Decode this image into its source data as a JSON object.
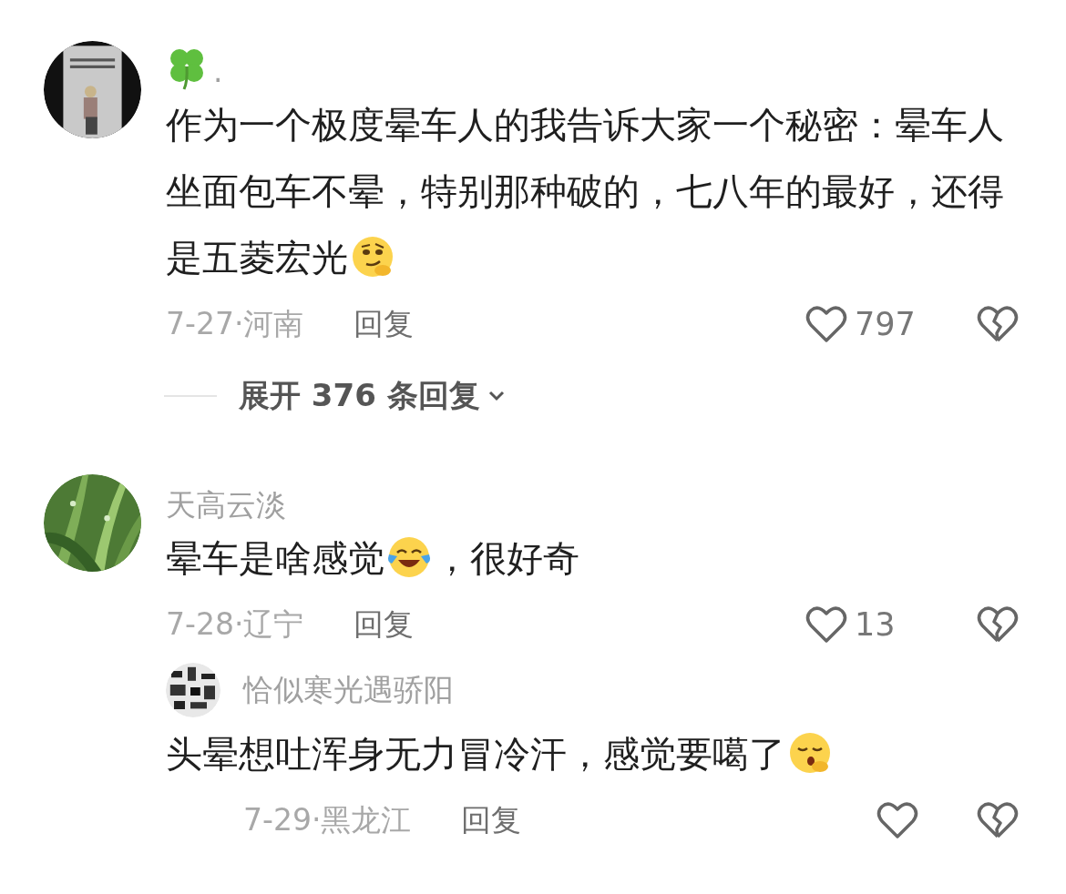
{
  "comments": [
    {
      "avatar": {
        "kind": "picture"
      },
      "name": [
        {
          "kind": "emoji"
        },
        {
          "kind": "text",
          "text": "."
        }
      ],
      "body": [
        {
          "kind": "text",
          "text": "作为一个极度晕车人的我告诉大家一个秘密：晕车人坐面包车不晕，特别那种破的，七八年的最好，还得是五菱宏光"
        },
        {
          "kind": "emoji"
        }
      ],
      "meta": "7-27·河南",
      "reply_label": "回复",
      "likes": "797",
      "expand": "展开 376 条回复"
    },
    {
      "avatar": {
        "kind": "picture"
      },
      "name": [
        {
          "kind": "text",
          "text": "天高云淡"
        }
      ],
      "body": [
        {
          "kind": "text",
          "text": "晕车是啥感觉"
        },
        {
          "kind": "emoji"
        },
        {
          "kind": "text",
          "text": "，很好奇"
        }
      ],
      "meta": "7-28·辽宁",
      "reply_label": "回复",
      "likes": "13",
      "replies": [
        {
          "avatar": {
            "kind": "picture"
          },
          "name": [
            {
              "kind": "text",
              "text": "恰似寒光遇骄阳"
            }
          ],
          "body": [
            {
              "kind": "text",
              "text": "头晕想吐浑身无力冒冷汗，感觉要噶了"
            },
            {
              "kind": "emoji"
            }
          ],
          "meta": "7-29·黑龙江",
          "reply_label": "回复"
        }
      ]
    }
  ]
}
